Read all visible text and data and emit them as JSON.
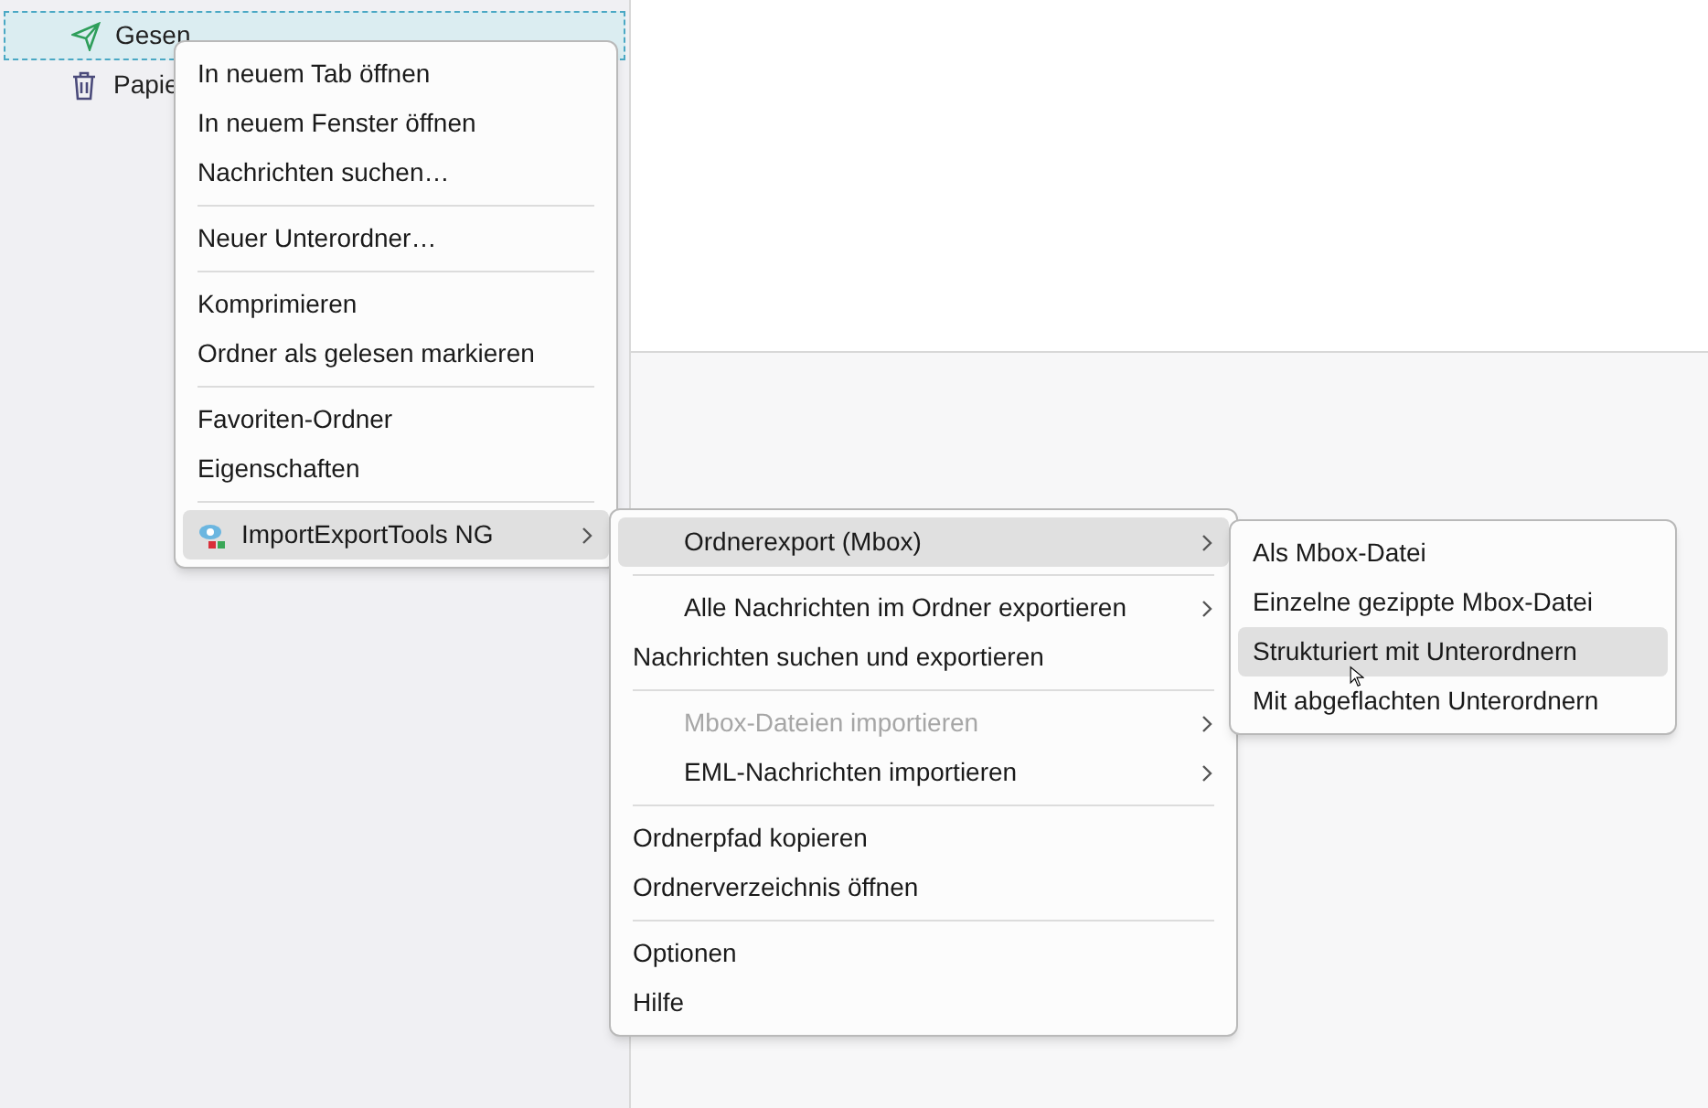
{
  "folders": [
    {
      "kind": "sent",
      "label": "Gesen",
      "selected": true
    },
    {
      "kind": "trash",
      "label": "Papie",
      "selected": false
    }
  ],
  "context_menu": [
    {
      "kind": "item",
      "label": "In neuem Tab öffnen",
      "selected": false
    },
    {
      "kind": "item",
      "label": "In neuem Fenster öffnen",
      "selected": false
    },
    {
      "kind": "item",
      "label": "Nachrichten suchen…",
      "selected": false
    },
    {
      "kind": "separator"
    },
    {
      "kind": "item",
      "label": "Neuer Unterordner…",
      "selected": false
    },
    {
      "kind": "separator"
    },
    {
      "kind": "item",
      "label": "Komprimieren",
      "selected": false
    },
    {
      "kind": "item",
      "label": "Ordner als gelesen markieren",
      "selected": false
    },
    {
      "kind": "separator"
    },
    {
      "kind": "item",
      "label": "Favoriten-Ordner",
      "selected": false
    },
    {
      "kind": "item",
      "label": "Eigenschaften",
      "selected": false
    },
    {
      "kind": "separator"
    },
    {
      "kind": "addon_item",
      "label": "ImportExportTools NG",
      "submenu": true,
      "selected": true
    }
  ],
  "submenu": [
    {
      "kind": "item",
      "label": "Ordnerexport (Mbox)",
      "indent": true,
      "submenu": true,
      "selected": true
    },
    {
      "kind": "separator"
    },
    {
      "kind": "item",
      "label": "Alle Nachrichten im Ordner exportieren",
      "indent": true,
      "submenu": true,
      "selected": false
    },
    {
      "kind": "item",
      "label": "Nachrichten suchen und exportieren",
      "selected": false
    },
    {
      "kind": "separator"
    },
    {
      "kind": "item",
      "label": "Mbox-Dateien importieren",
      "indent": true,
      "submenu": true,
      "disabled": true,
      "selected": false
    },
    {
      "kind": "item",
      "label": "EML-Nachrichten importieren",
      "indent": true,
      "submenu": true,
      "selected": false
    },
    {
      "kind": "separator"
    },
    {
      "kind": "item",
      "label": "Ordnerpfad kopieren",
      "selected": false
    },
    {
      "kind": "item",
      "label": "Ordnerverzeichnis öffnen",
      "selected": false
    },
    {
      "kind": "separator"
    },
    {
      "kind": "item",
      "label": "Optionen",
      "selected": false
    },
    {
      "kind": "item",
      "label": "Hilfe",
      "selected": false
    }
  ],
  "export_menu": [
    {
      "kind": "item",
      "label": "Als Mbox-Datei",
      "selected": false
    },
    {
      "kind": "item",
      "label": "Einzelne gezippte Mbox-Datei",
      "selected": false
    },
    {
      "kind": "item",
      "label": "Strukturiert mit Unterordnern",
      "selected": true
    },
    {
      "kind": "item",
      "label": "Mit abgeflachten Unterordnern",
      "selected": false
    }
  ]
}
